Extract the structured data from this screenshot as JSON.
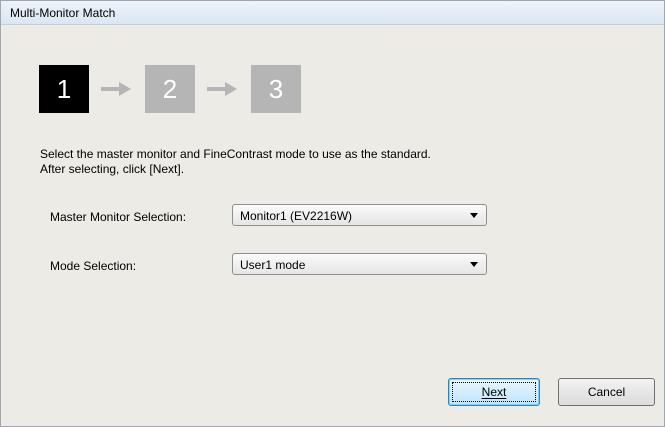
{
  "window": {
    "title": "Multi-Monitor Match"
  },
  "steps": [
    {
      "number": "1",
      "state": "active"
    },
    {
      "number": "2",
      "state": "inactive"
    },
    {
      "number": "3",
      "state": "inactive"
    }
  ],
  "instructions": {
    "line1": "Select the master monitor and FineContrast mode to use as the standard.",
    "line2": "After selecting, click [Next]."
  },
  "form": {
    "monitor_label": "Master Monitor Selection:",
    "monitor_value": "Monitor1 (EV2216W)",
    "mode_label": "Mode Selection:",
    "mode_value": "User1 mode"
  },
  "buttons": {
    "next_label": "Next",
    "cancel_label": "Cancel"
  },
  "colors": {
    "active_step": "#000000",
    "inactive_step": "#b5b5b5",
    "arrow": "#b5b5b5"
  },
  "icons": [
    "right-arrow-icon",
    "chevron-down-icon"
  ]
}
